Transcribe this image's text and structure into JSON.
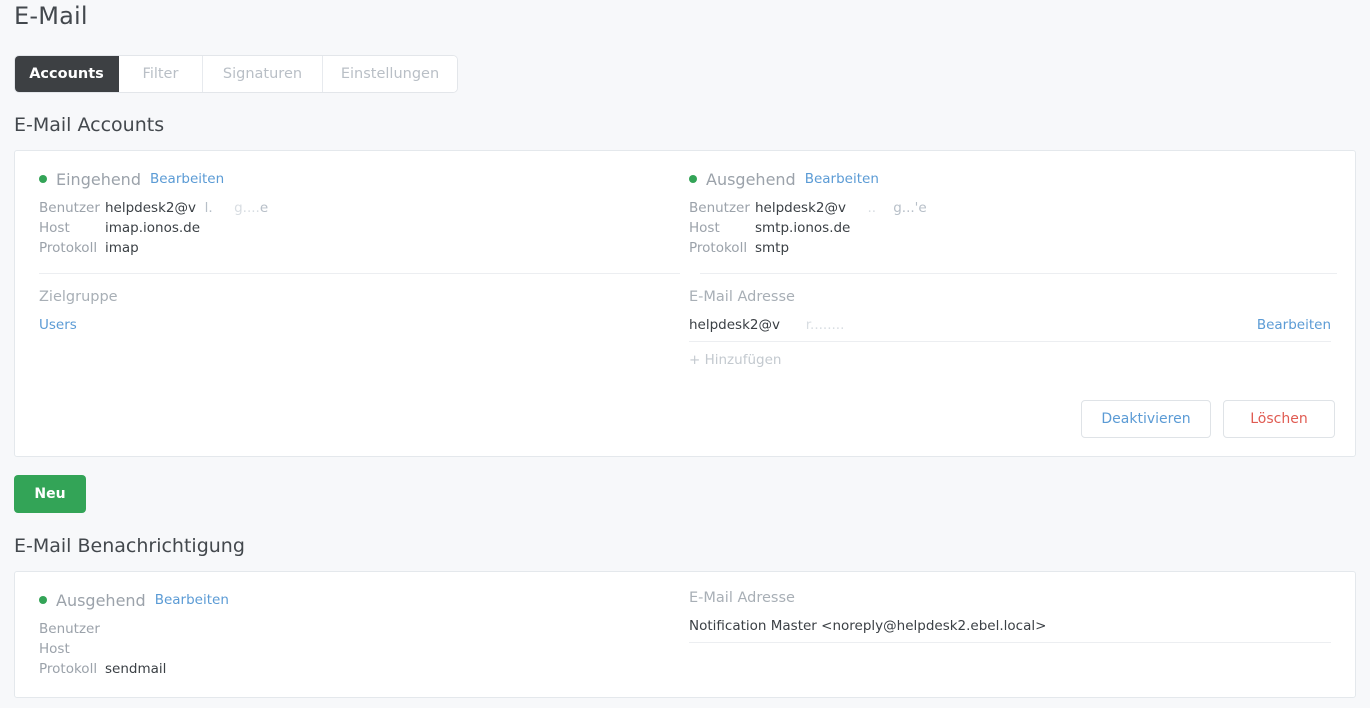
{
  "page": {
    "title": "E-Mail"
  },
  "tabs": [
    {
      "label": "Accounts",
      "active": true
    },
    {
      "label": "Filter",
      "active": false
    },
    {
      "label": "Signaturen",
      "active": false
    },
    {
      "label": "Einstellungen",
      "active": false
    }
  ],
  "sections": {
    "accounts_heading": "E-Mail Accounts",
    "notification_heading": "E-Mail Benachrichtigung"
  },
  "account_card": {
    "incoming": {
      "status": "online",
      "name": "Eingehend",
      "edit_label": "Bearbeiten",
      "fields": [
        {
          "key": "Benutzer",
          "value": "helpdesk2@v",
          "redacted_tail": "e"
        },
        {
          "key": "Host",
          "value": "imap.ionos.de"
        },
        {
          "key": "Protokoll",
          "value": "imap"
        }
      ]
    },
    "outgoing": {
      "status": "online",
      "name": "Ausgehend",
      "edit_label": "Bearbeiten",
      "fields": [
        {
          "key": "Benutzer",
          "value": "helpdesk2@v",
          "redacted_tail": "'e"
        },
        {
          "key": "Host",
          "value": "smtp.ionos.de"
        },
        {
          "key": "Protokoll",
          "value": "smtp"
        }
      ]
    },
    "target_group": {
      "label": "Zielgruppe",
      "value": "Users"
    },
    "email_address": {
      "label": "E-Mail Adresse",
      "value": "helpdesk2@v",
      "edit_label": "Bearbeiten",
      "add_label": "+ Hinzufügen"
    },
    "actions": {
      "deactivate_label": "Deaktivieren",
      "delete_label": "Löschen"
    }
  },
  "new_button_label": "Neu",
  "notification_card": {
    "outgoing": {
      "status": "online",
      "name": "Ausgehend",
      "edit_label": "Bearbeiten",
      "fields": [
        {
          "key": "Benutzer",
          "value": ""
        },
        {
          "key": "Host",
          "value": ""
        },
        {
          "key": "Protokoll",
          "value": "sendmail"
        }
      ]
    },
    "email_address": {
      "label": "E-Mail Adresse",
      "value": "Notification Master <noreply@helpdesk2.ebel.local>"
    }
  },
  "colors": {
    "accent_green": "#33a457",
    "link_blue": "#5b9bd5",
    "danger_red": "#e05b52",
    "active_tab_bg": "#3d4043",
    "page_bg": "#f7f8fa"
  }
}
